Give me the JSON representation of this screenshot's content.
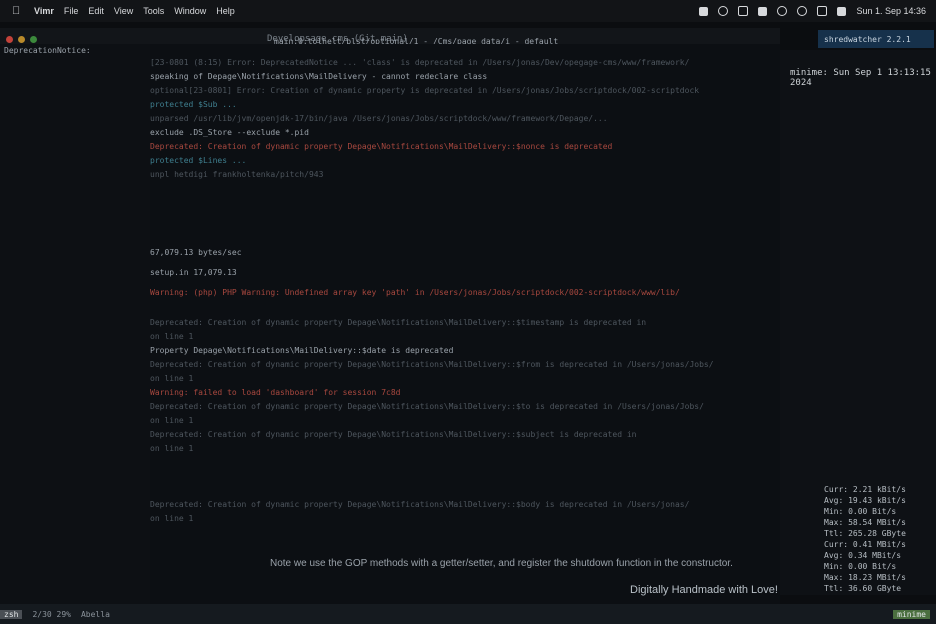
{
  "menubar": {
    "app": "Vimr",
    "menus": [
      "Vimr",
      "File",
      "Edit",
      "View",
      "Tools",
      "Window",
      "Help"
    ],
    "datetime": "Sun 1. Sep 14:36"
  },
  "window": {
    "title": "Developsage cms (Git main)",
    "subtitle": "main:0:tolhelt/blst/optional/1 - /Cms/page data/i - default",
    "pill": "shredwatcher 2.2.1"
  },
  "right_pane": {
    "clock": "minime: Sun Sep 1 13:13:15 2024",
    "net": [
      "Curr: 2.21 kBit/s",
      "Avg: 19.43 kBit/s",
      "Min: 0.00 Bit/s",
      "Max: 58.54 MBit/s",
      "Ttl: 265.28 GByte",
      "Curr: 0.41 MBit/s",
      "Avg: 0.34 MBit/s",
      "Min: 0.00 Bit/s",
      "Max: 18.23 MBit/s",
      "Ttl: 36.60 GByte"
    ]
  },
  "terminal": {
    "lines": [
      "DeprecationNotice:",
      "[23-0801 (8:15) Error: DeprecatedNotice ... 'class' is deprecated in /Users/jonas/Dev/opegage-cms/www/framework/",
      "  speaking of Depage\\Notifications\\MailDelivery - cannot redeclare class",
      "  optional[23-0801] Error: Creation of dynamic property is deprecated in /Users/jonas/Jobs/scriptdock/002-scriptdock",
      "  protected $Sub ...",
      "  unparsed /usr/lib/jvm/openjdk-17/bin/java /Users/jonas/Jobs/scriptdock/www/framework/Depage/...",
      "  exclude .DS_Store --exclude *.pid",
      "  Deprecated: Creation of dynamic property Depage\\Notifications\\MailDelivery::$nonce is deprecated",
      "  protected $Lines ...",
      "  unpl hetdigi frankholtenka/pitch/943",
      "  67,079.13 bytes/sec",
      "  setup.in 17,079.13",
      "  Warning: (php) PHP Warning: Undefined array key 'path' in /Users/jonas/Jobs/scriptdock/002-scriptdock/www/lib/",
      "  Deprecated: Creation of dynamic property Depage\\Notifications\\MailDelivery::$timestamp is deprecated in",
      "  on line 1",
      "  Property Depage\\Notifications\\MailDelivery::$date is deprecated",
      "  Deprecated: Creation of dynamic property Depage\\Notifications\\MailDelivery::$from is deprecated in /Users/jonas/Jobs/",
      "  on line 1",
      "  Warning: failed to load 'dashboard' for session 7c8d",
      "  Deprecated: Creation of dynamic property Depage\\Notifications\\MailDelivery::$to is deprecated in /Users/jonas/Jobs/",
      "  on line 1",
      "  Deprecated: Creation of dynamic property Depage\\Notifications\\MailDelivery::$subject is deprecated in",
      "  on line 1",
      "  Deprecated: Creation of dynamic property Depage\\Notifications\\MailDelivery::$body is deprecated in /Users/jonas/",
      "  on line 1"
    ],
    "status_left": "zsh",
    "status_mid": "2/30 29%",
    "status_right": "minime",
    "status_user": "Abella"
  },
  "browser": {
    "note": "Note we use the GOP methods with a getter/setter, and register the shutdown function in the constructor.",
    "footer": "Digitally Handmade with Love!"
  }
}
